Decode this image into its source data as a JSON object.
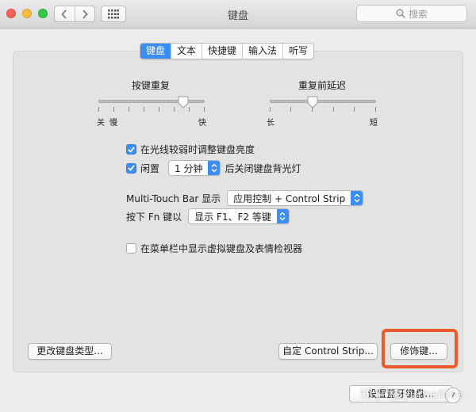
{
  "window": {
    "title": "键盘"
  },
  "toolbar": {
    "back_icon": "chevron-left-icon",
    "forward_icon": "chevron-right-icon",
    "grid_icon": "grid-icon",
    "search_placeholder": "搜索"
  },
  "tabs": [
    {
      "label": "键盘",
      "active": true
    },
    {
      "label": "文本",
      "active": false
    },
    {
      "label": "快捷键",
      "active": false
    },
    {
      "label": "输入法",
      "active": false
    },
    {
      "label": "听写",
      "active": false
    }
  ],
  "key_repeat": {
    "title": "按键重复",
    "min_label": "关",
    "slow_label": "慢",
    "max_label": "快",
    "value_fraction": 0.8
  },
  "repeat_delay": {
    "title": "重复前延迟",
    "min_label": "长",
    "max_label": "短",
    "value_fraction": 0.4
  },
  "options": {
    "brightness": {
      "label": "在光线较弱时调整键盘亮度",
      "checked": true
    },
    "idle": {
      "label": "闲置",
      "checked": true,
      "duration": "1 分钟",
      "suffix": "后关闭键盘背光灯"
    },
    "touchbar": {
      "label": "Multi-Touch Bar 显示",
      "value": "应用控制 + Control Strip"
    },
    "fn": {
      "label": "按下 Fn 键以",
      "value": "显示 F1、F2 等键"
    },
    "menubar": {
      "label": "在菜单栏中显示虚拟键盘及表情检视器",
      "checked": false
    }
  },
  "buttons": {
    "change_type": "更改键盘类型...",
    "customize_strip": "自定 Control Strip...",
    "modifier": "修饰键...",
    "bluetooth": "设置蓝牙键盘...",
    "help": "?"
  },
  "watermark": "知乎 @yumallice",
  "colors": {
    "accent": "#3b8df7",
    "highlight": "#ee5a2a"
  }
}
